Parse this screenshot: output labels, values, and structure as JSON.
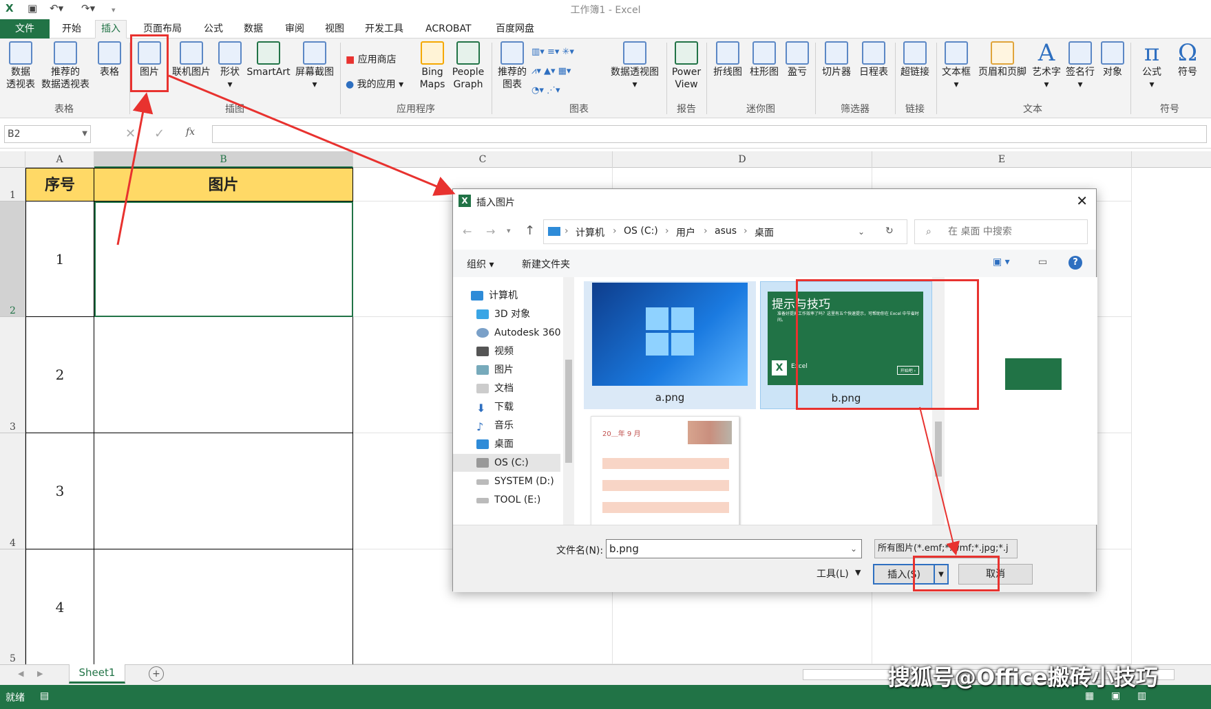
{
  "window": {
    "title": "工作簿1 - Excel"
  },
  "tabs": [
    "文件",
    "开始",
    "插入",
    "页面布局",
    "公式",
    "数据",
    "审阅",
    "视图",
    "开发工具",
    "ACROBAT",
    "百度网盘"
  ],
  "ribbon": {
    "buttons": [
      {
        "l1": "数据",
        "l2": "透视表"
      },
      {
        "l1": "推荐的",
        "l2": "数据透视表"
      },
      {
        "l1": "表格",
        "l2": ""
      },
      {
        "l1": "图片",
        "l2": ""
      },
      {
        "l1": "联机图片",
        "l2": ""
      },
      {
        "l1": "形状",
        "l2": "▾"
      },
      {
        "l1": "SmartArt",
        "l2": ""
      },
      {
        "l1": "屏幕截图",
        "l2": "▾"
      },
      {
        "l1": "应用商店",
        "l2": ""
      },
      {
        "l1": "我的应用",
        "l2": "▾"
      },
      {
        "l1": "Bing",
        "l2": "Maps"
      },
      {
        "l1": "People",
        "l2": "Graph"
      },
      {
        "l1": "推荐的",
        "l2": "图表"
      },
      {
        "l1": "数据透视图",
        "l2": "▾"
      },
      {
        "l1": "Power",
        "l2": "View"
      },
      {
        "l1": "折线图",
        "l2": ""
      },
      {
        "l1": "柱形图",
        "l2": ""
      },
      {
        "l1": "盈亏",
        "l2": ""
      },
      {
        "l1": "切片器",
        "l2": ""
      },
      {
        "l1": "日程表",
        "l2": ""
      },
      {
        "l1": "超链接",
        "l2": ""
      },
      {
        "l1": "文本框",
        "l2": "▾"
      },
      {
        "l1": "页眉和页脚",
        "l2": ""
      },
      {
        "l1": "艺术字",
        "l2": "▾"
      },
      {
        "l1": "签名行",
        "l2": "▾"
      },
      {
        "l1": "对象",
        "l2": ""
      },
      {
        "l1": "公式",
        "l2": "▾"
      },
      {
        "l1": "符号",
        "l2": ""
      }
    ],
    "groups": [
      "表格",
      "插图",
      "应用程序",
      "图表",
      "报告",
      "迷你图",
      "筛选器",
      "链接",
      "文本",
      "符号"
    ]
  },
  "formula_bar": {
    "name_box": "B2",
    "fx": "fx",
    "value": ""
  },
  "sheet": {
    "columns": [
      "A",
      "B",
      "C",
      "D",
      "E"
    ],
    "rows": [
      "1",
      "2",
      "3",
      "4",
      "5"
    ],
    "header": [
      "序号",
      "图片"
    ],
    "numbers": [
      "1",
      "2",
      "3",
      "4"
    ],
    "tab": "Sheet1"
  },
  "status": {
    "ready": "就绪"
  },
  "dialog": {
    "title": "插入图片",
    "breadcrumb": [
      "计算机",
      "OS (C:)",
      "用户",
      "asus",
      "桌面"
    ],
    "search_placeholder": "在 桌面 中搜索",
    "toolbar": {
      "organize": "组织 ▾",
      "new_folder": "新建文件夹"
    },
    "nav": [
      "计算机",
      "3D 对象",
      "Autodesk 360",
      "视频",
      "图片",
      "文档",
      "下载",
      "音乐",
      "桌面",
      "OS (C:)",
      "SYSTEM (D:)",
      "TOOL (E:)"
    ],
    "files": [
      {
        "name": "a.png"
      },
      {
        "name": "b.png",
        "thumb_title": "提示与技巧",
        "thumb_text": "准备好提高工作效率了吗？这里有五个快速提示，可帮助你在 Excel 中节省时间。",
        "thumb_brand": "Excel",
        "thumb_btn": "开始吧 ›"
      },
      {
        "name": "",
        "thumb_title": "20＿年 9 月"
      }
    ],
    "filename_label": "文件名(N):",
    "filename_value": "b.png",
    "filter": "所有图片(*.emf;*.wmf;*.jpg;*.j",
    "tools": "工具(L)",
    "insert_btn": "插入(S)",
    "cancel_btn": "取消"
  },
  "watermark": "搜狐号@Office搬砖小技巧",
  "colors": {
    "excel_green": "#217346",
    "header_yellow": "#ffd966",
    "highlight_red": "#e8322f"
  }
}
